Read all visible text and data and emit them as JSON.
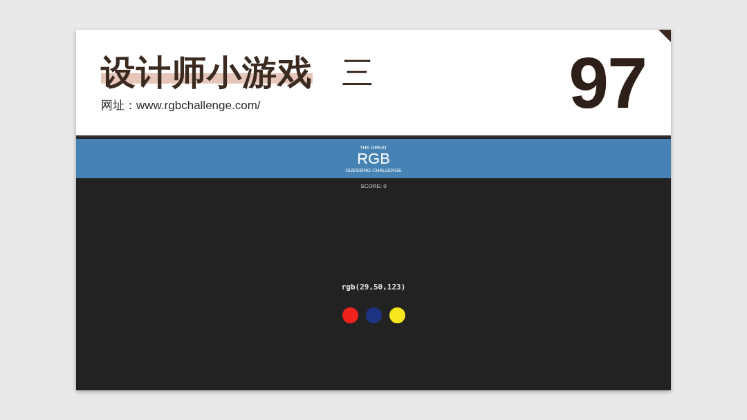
{
  "slide": {
    "title": "设计师小游戏",
    "title_mark": "三",
    "url": "网址：www.rgbchallenge.com/",
    "number": "97"
  },
  "game": {
    "kicker": "THE GREAT",
    "title": "RGB",
    "subtitle": "GUESSING CHALLENGE",
    "score": "SCORE: 0",
    "prompt": "rgb(29,50,123)",
    "options": [
      {
        "color": "#f0231c"
      },
      {
        "color": "#1e3282"
      },
      {
        "color": "#f5e61e"
      }
    ]
  }
}
